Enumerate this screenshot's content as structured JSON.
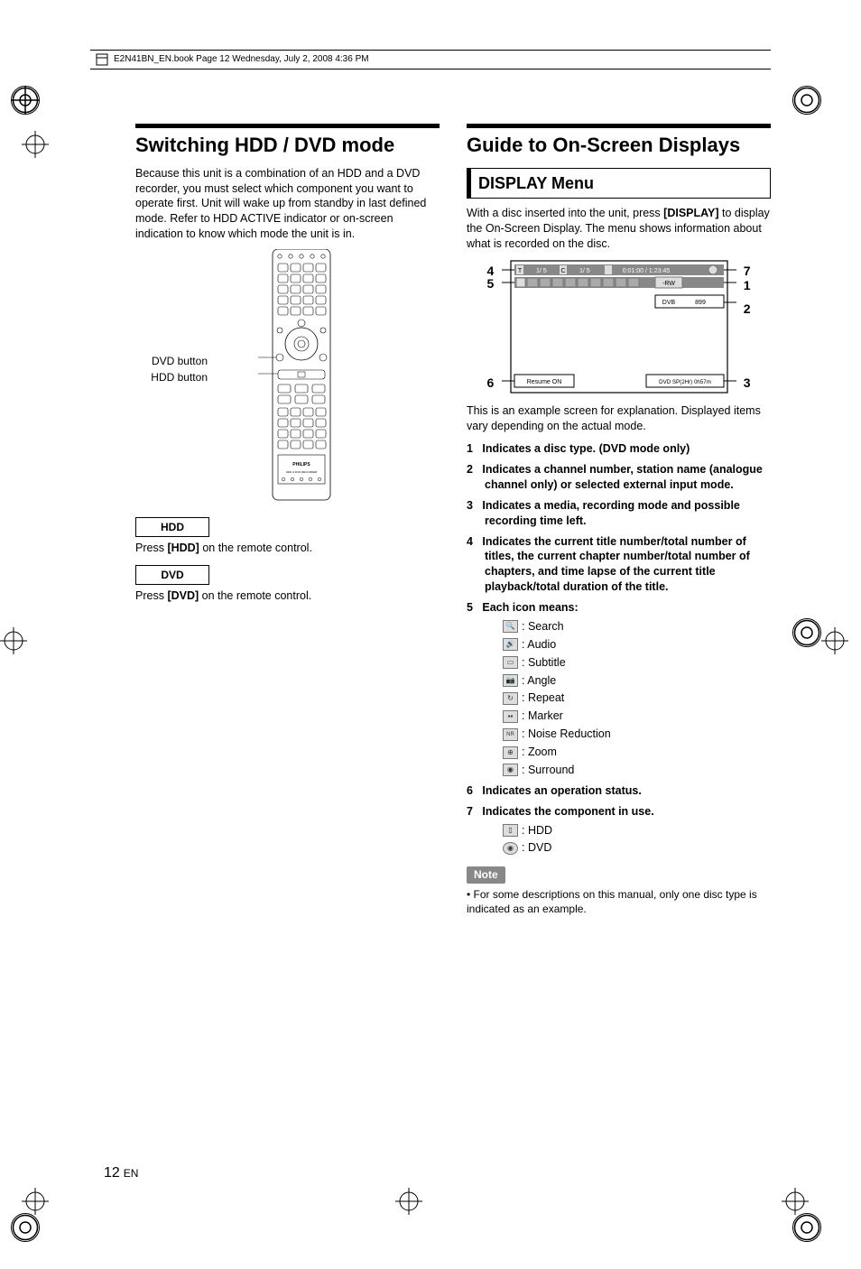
{
  "header": "E2N41BN_EN.book  Page 12  Wednesday, July 2, 2008  4:36 PM",
  "left": {
    "title": "Switching HDD / DVD mode",
    "intro": "Because this unit is a combination of an HDD and a DVD recorder, you must select which component you want to operate first. Unit will wake up from standby in last defined mode. Refer to HDD ACTIVE indicator or on-screen indication to know which mode the unit is in.",
    "labels": {
      "dvd": "DVD button",
      "hdd": "HDD button"
    },
    "remote_brand": "PHILIPS",
    "remote_sub": "HDD & DVD RECORDER",
    "hdd_badge": "HDD",
    "hdd_text_pre": "Press ",
    "hdd_text_bold": "[HDD]",
    "hdd_text_post": " on the remote control.",
    "dvd_badge": "DVD",
    "dvd_text_pre": "Press ",
    "dvd_text_bold": "[DVD]",
    "dvd_text_post": " on the remote control."
  },
  "right": {
    "title": "Guide to On-Screen Displays",
    "section": "DISPLAY Menu",
    "intro_pre": "With a disc inserted into the unit, press ",
    "intro_bold": "[DISPLAY]",
    "intro_post": " to display the On-Screen Display. The menu shows information about what is recorded on the disc.",
    "screen": {
      "titleinfo1": "1/ 5",
      "chapinfo": "1/ 5",
      "time": "0:01:00 / 1:23:45",
      "disc_badge": "-RW",
      "ch_label": "DVB",
      "ch_num": "899",
      "resume": "Resume ON",
      "rec_info": "DVD SP(2Hr)      0h57m",
      "T": "T",
      "C": "C",
      "clock": "⏱"
    },
    "caption": "This is an example screen for explanation. Displayed items vary depending on the actual mode.",
    "items": [
      "Indicates a disc type. (DVD mode only)",
      "Indicates a channel number, station name (analogue channel only) or selected external input mode.",
      "Indicates a media, recording mode and possible recording time left.",
      "Indicates the current title number/total number of titles, the current chapter number/total number of chapters, and time lapse of the current title playback/total duration of the title.",
      "Each icon means:",
      "Indicates an operation status.",
      "Indicates the component in use."
    ],
    "icons5": [
      {
        "label": "Search"
      },
      {
        "label": "Audio"
      },
      {
        "label": "Subtitle"
      },
      {
        "label": "Angle"
      },
      {
        "label": "Repeat"
      },
      {
        "label": "Marker"
      },
      {
        "label": "Noise Reduction"
      },
      {
        "label": "Zoom"
      },
      {
        "label": "Surround"
      }
    ],
    "icons7": [
      {
        "label": "HDD"
      },
      {
        "label": "DVD"
      }
    ],
    "note_label": "Note",
    "note_text": "For some descriptions on this manual, only one disc type is indicated as an example."
  },
  "footer": {
    "page": "12",
    "lang": "EN"
  }
}
